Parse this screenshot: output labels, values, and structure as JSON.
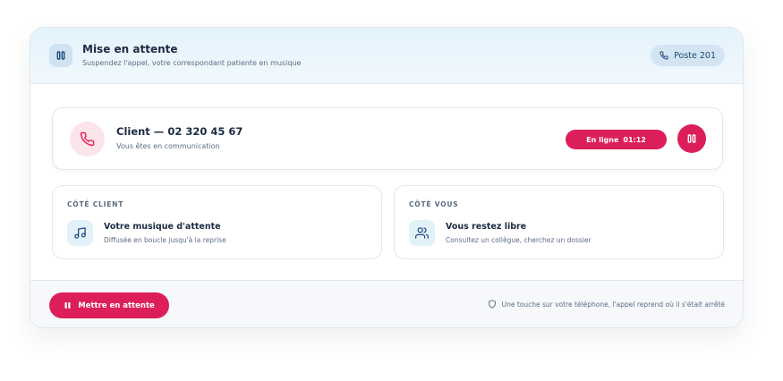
{
  "header": {
    "icon": "pause-icon",
    "title": "Mise en attente",
    "subtitle": "Suspendez l'appel, votre correspondant patiente en musique",
    "extension_icon": "phone-icon",
    "extension_label": "Poste 201"
  },
  "call": {
    "icon": "phone-icon",
    "title": "Client — 02 320 45 67",
    "status_text": "Vous êtes en communication",
    "status_label": "En ligne",
    "timer": "01:12",
    "pause_button_icon": "pause-icon"
  },
  "panels": [
    {
      "label": "CÔTÉ CLIENT",
      "icon": "music-note-icon",
      "title": "Votre musique d'attente",
      "description": "Diffusée en boucle jusqu'à la reprise"
    },
    {
      "label": "CÔTÉ VOUS",
      "icon": "users-icon",
      "title": "Vous restez libre",
      "description": "Consultez un collègue, cherchez un dossier"
    }
  ],
  "footer": {
    "hold_button_label": "Mettre en attente",
    "hold_button_icon": "pause-icon",
    "note_icon": "shield-icon",
    "note": "Une touche sur votre téléphone, l'appel reprend où il s'était arrêté"
  },
  "colors": {
    "accent": "#dc1f5a",
    "text": "#1c2b44",
    "muted": "#5b6b82",
    "header_bg": "#e3f3fb",
    "icon_tint": "#1f4a78"
  }
}
